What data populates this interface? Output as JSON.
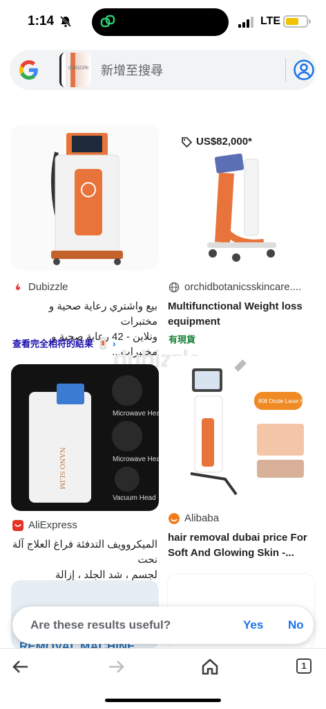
{
  "status_bar": {
    "time": "1:14",
    "network": "LTE",
    "battery_level": 0.6,
    "battery_color": "#f2c200"
  },
  "search_bar": {
    "placeholder": "新增至搜尋",
    "thumbnail_text": "dubizzle",
    "icons": [
      "google-logo",
      "account-icon"
    ]
  },
  "results": [
    {
      "source": "Dubizzle",
      "source_icon": "flame-icon",
      "title_lines": [
        "بيع واشتري رعاية صحية و مختبرات",
        "ونلاين - 42 رعاية صحية و مختبرات..."
      ],
      "link": "查看完全相符的結果"
    },
    {
      "source": "orchidbotanicsskincare....",
      "source_icon": "globe-icon",
      "price": "US$82,000*",
      "title": "Multifunctional Weight loss equipment",
      "stock": "有現貨"
    },
    {
      "source": "AliExpress",
      "source_icon": "aliexpress-icon",
      "title_lines": [
        "الميكروويف التدفئة فراغ العلاج آلة نحت",
        "لجسم ، شد الجلد ، إزالة السيلوليت ،..."
      ],
      "image_labels": [
        "Microwave Head",
        "Microwave Head",
        "Vacuum Head"
      ],
      "image_brand": "NANO SLIM"
    },
    {
      "source": "Alibaba",
      "source_icon": "alibaba-icon",
      "title": "hair removal dubai price For Soft And Glowing Skin -...",
      "image_badge": "808 Diode Laser Hair Removal"
    }
  ],
  "partial_card_text": "REMOVAL MACHINE",
  "watermark": "dubizzle",
  "feedback": {
    "question": "Are these results useful?",
    "yes": "Yes",
    "no": "No"
  },
  "bottom_nav": {
    "tab_count": "1",
    "items": [
      "back-icon",
      "forward-icon",
      "home-icon",
      "tabs-icon"
    ]
  },
  "colors": {
    "link_blue": "#1a73e8",
    "stock_green": "#188038",
    "accent_orange": "#e8743b"
  }
}
